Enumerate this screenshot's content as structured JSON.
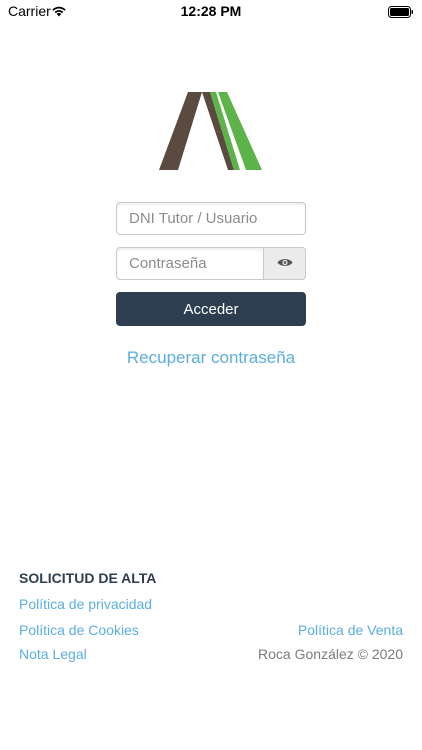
{
  "status_bar": {
    "carrier": "Carrier",
    "time": "12:28 PM"
  },
  "login": {
    "user_placeholder": "DNI Tutor / Usuario",
    "password_placeholder": "Contraseña",
    "submit_label": "Acceder",
    "recover_label": "Recuperar contraseña"
  },
  "footer": {
    "signup_title": "SOLICITUD DE ALTA",
    "privacy_link": "Política de privacidad",
    "cookies_link": "Política de Cookies",
    "sales_link": "Política de Venta",
    "legal_link": "Nota Legal",
    "copyright": "Roca González © 2020"
  },
  "colors": {
    "primary": "#2c3e50",
    "link": "#5aaee0",
    "logo_brown": "#5a4a40",
    "logo_green": "#5cb34a"
  },
  "icons": [
    "wifi-icon",
    "battery-icon",
    "eye-icon"
  ]
}
